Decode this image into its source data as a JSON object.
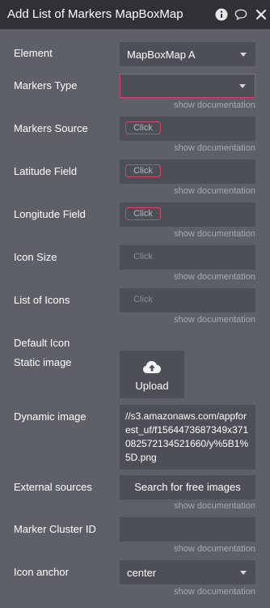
{
  "header": {
    "title": "Add List of Markers MapBoxMap"
  },
  "fields": {
    "element": {
      "label": "Element",
      "value": "MapBoxMap A"
    },
    "markers_type": {
      "label": "Markers Type",
      "value": "",
      "doc": "show documentation"
    },
    "markers_source": {
      "label": "Markers Source",
      "button": "Click",
      "doc": "show documentation"
    },
    "latitude_field": {
      "label": "Latitude Field",
      "button": "Click",
      "doc": "show documentation"
    },
    "longitude_field": {
      "label": "Longitude Field",
      "button": "Click",
      "doc": "show documentation"
    },
    "icon_size": {
      "label": "Icon Size",
      "button": "Click",
      "doc": "show documentation"
    },
    "list_of_icons": {
      "label": "List of Icons",
      "button": "Click",
      "doc": "show documentation"
    },
    "default_icon": {
      "label": "Default Icon"
    },
    "static_image": {
      "label": "Static image",
      "button": "Upload"
    },
    "dynamic_image": {
      "label": "Dynamic image",
      "value": "//s3.amazonaws.com/appforest_uf/f1564473687349x371082572134521660/y%5B1%5D.png"
    },
    "external_sources": {
      "label": "External sources",
      "button": "Search for free images",
      "doc": "show documentation"
    },
    "marker_cluster_id": {
      "label": "Marker Cluster ID",
      "value": "",
      "doc": "show documentation"
    },
    "icon_anchor": {
      "label": "Icon anchor",
      "value": "center",
      "doc": "show documentation"
    }
  },
  "colors": {
    "panel_bg": "#5d6066",
    "titlebar_bg": "#2f3135",
    "field_bg": "#4c4f55",
    "accent": "#d8456c",
    "doc_text": "#a6a9ad"
  }
}
